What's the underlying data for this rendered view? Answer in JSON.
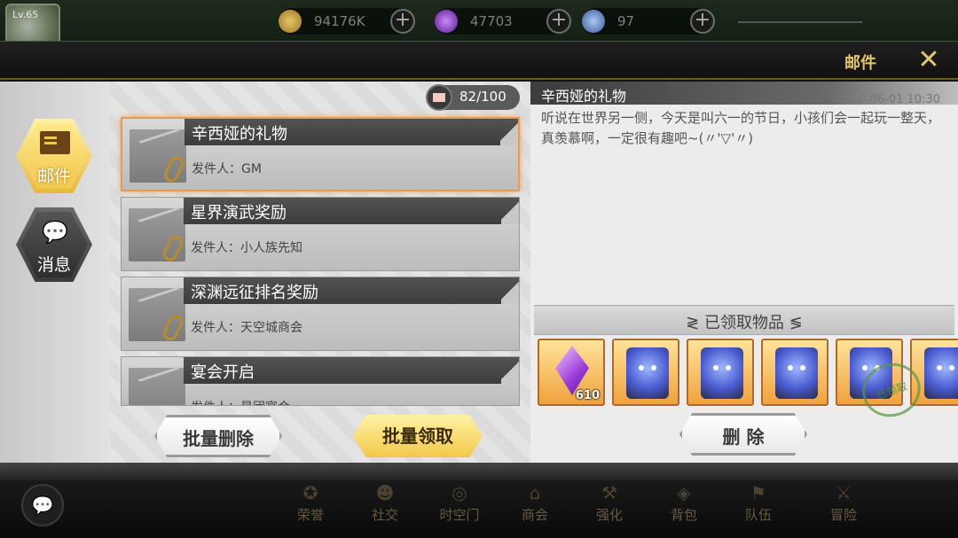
{
  "hud": {
    "level": "Lv.65",
    "resources": [
      {
        "name": "gold",
        "icon": "gold-coin-icon",
        "value": "94176K",
        "color": "#c89a3a"
      },
      {
        "name": "crystal",
        "icon": "purple-crystal-icon",
        "value": "47703",
        "color": "#8a4ad0"
      },
      {
        "name": "stamina",
        "icon": "orb-icon",
        "value": "97",
        "color": "#5a8ad0"
      }
    ]
  },
  "header": {
    "title": "邮件",
    "close_icon": "close-icon"
  },
  "nav": {
    "mail_label": "邮件",
    "message_label": "消息"
  },
  "list": {
    "counter": "82/100",
    "mails": [
      {
        "subject": "辛西娅的礼物",
        "sender": "发件人：GM",
        "selected": true
      },
      {
        "subject": "星界演武奖励",
        "sender": "发件人：小人族先知",
        "selected": false
      },
      {
        "subject": "深渊远征排名奖励",
        "sender": "发件人：天空城商会",
        "selected": false
      },
      {
        "subject": "宴会开启",
        "sender": "发件人：星团宴会",
        "selected": false
      }
    ],
    "batch_delete": "批量删除",
    "batch_claim": "批量领取"
  },
  "detail": {
    "title": "辛西娅的礼物",
    "date": "2020-06-01 10:30",
    "body": "听说在世界另一侧，今天是叫六一的节日，小孩们会一起玩一整天，真羡慕啊，一定很有趣吧~(〃'▽'〃)",
    "received_label": "≷ 已领取物品 ≶",
    "items": [
      {
        "type": "gem",
        "qty": "610"
      },
      {
        "type": "card",
        "qty": ""
      },
      {
        "type": "card",
        "qty": ""
      },
      {
        "type": "card",
        "qty": ""
      },
      {
        "type": "card",
        "qty": ""
      },
      {
        "type": "card",
        "qty": ""
      }
    ],
    "stamp_text": "已领取",
    "delete": "删 除"
  },
  "bottom_nav": [
    {
      "label": "荣誉",
      "icon": "honor-icon"
    },
    {
      "label": "社交",
      "icon": "social-icon"
    },
    {
      "label": "时空门",
      "icon": "portal-icon"
    },
    {
      "label": "商会",
      "icon": "shop-icon"
    },
    {
      "label": "强化",
      "icon": "enhance-icon"
    },
    {
      "label": "背包",
      "icon": "bag-icon"
    },
    {
      "label": "队伍",
      "icon": "team-icon"
    },
    {
      "label": "冒险",
      "icon": "adventure-icon"
    }
  ]
}
